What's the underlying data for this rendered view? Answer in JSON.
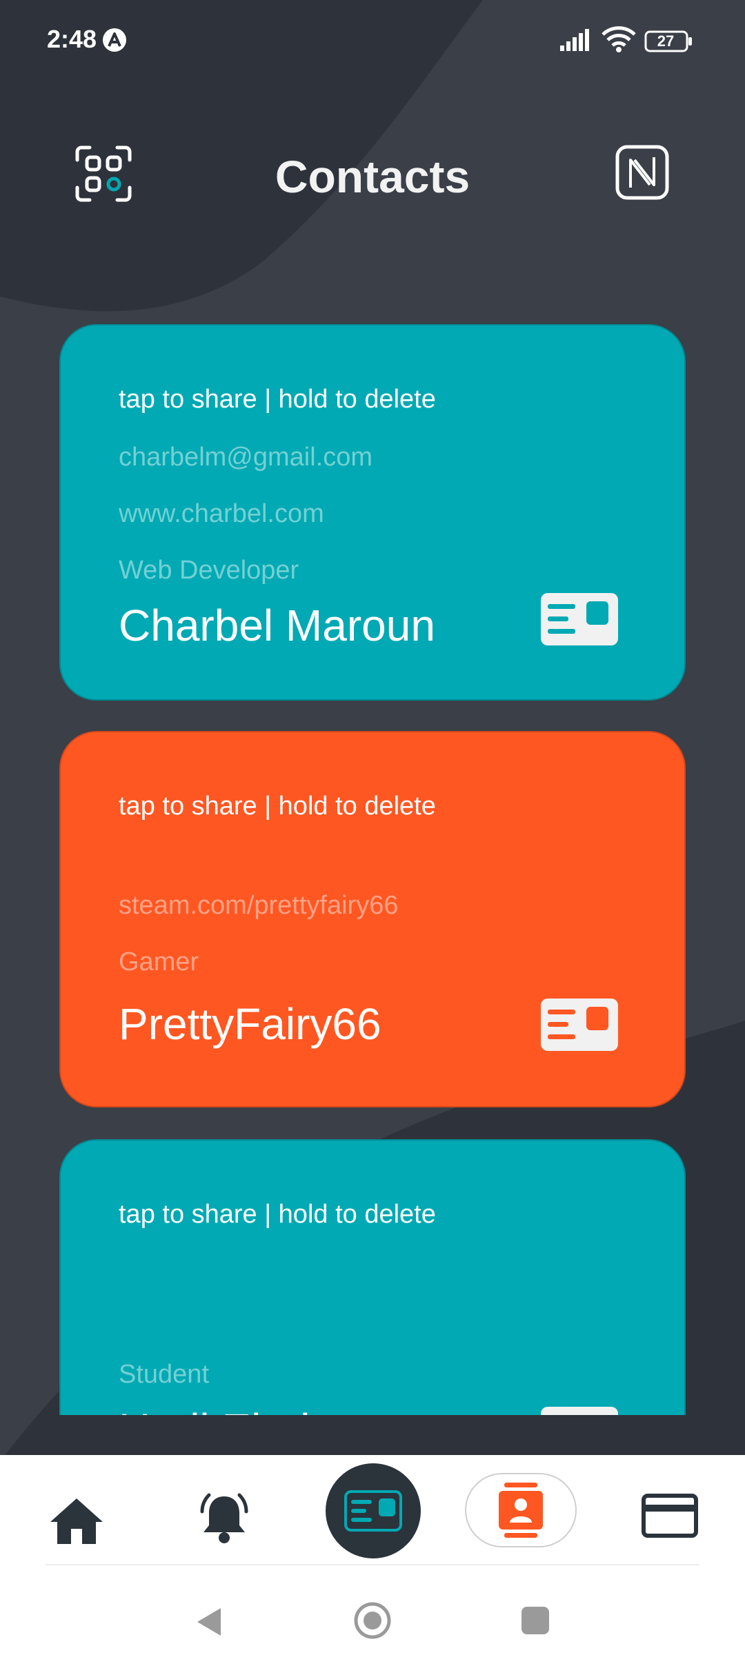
{
  "status_bar": {
    "time": "2:48",
    "battery": "27"
  },
  "header": {
    "title": "Contacts",
    "left_icon": "qr-scan-icon",
    "right_icon": "nfc-icon"
  },
  "cards": [
    {
      "color": "#00a9b3",
      "hint": "tap to share | hold to delete",
      "email": "charbelm@gmail.com",
      "website": "www.charbel.com",
      "title": "Web Developer",
      "name": "Charbel Maroun"
    },
    {
      "color": "#ff5722",
      "hint": "tap to share | hold to delete",
      "website": "steam.com/prettyfairy66",
      "title": "Gamer",
      "name": "PrettyFairy66"
    },
    {
      "color": "#00a9b3",
      "hint": "tap to share | hold to delete",
      "title": "Student",
      "name": "Hadi Elrai"
    }
  ],
  "bottom_nav": {
    "items": [
      "home-icon",
      "bell-icon",
      "card-icon",
      "contacts-icon",
      "wallet-icon"
    ],
    "active": "contacts",
    "accent": "#ff5722"
  },
  "colors": {
    "background": "#3a3f48",
    "teal": "#00a9b3",
    "orange": "#ff5722",
    "dark": "#2b333b"
  }
}
